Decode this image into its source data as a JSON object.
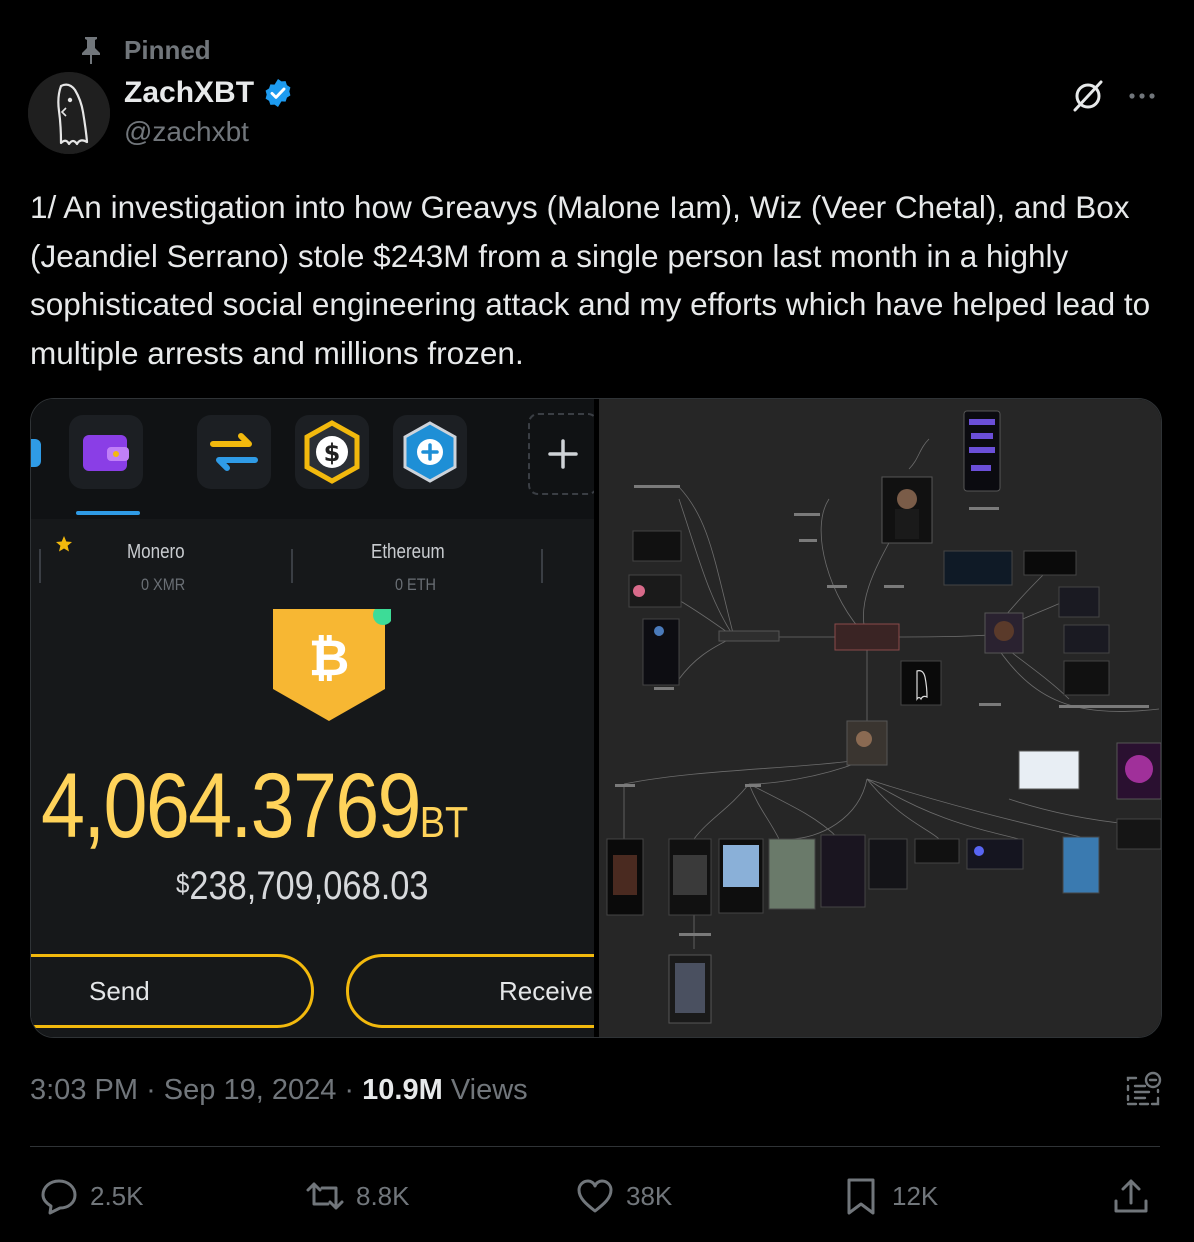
{
  "pinned": {
    "label": "Pinned"
  },
  "author": {
    "name": "ZachXBT",
    "handle": "@zachxbt",
    "verified": true
  },
  "tweet": {
    "text": "1/ An investigation into how Greavys (Malone Iam), Wiz (Veer Chetal), and Box (Jeandiel Serrano) stole $243M from a single person last month in a highly sophisticated social engineering attack and my efforts which have helped lead to multiple arrests and millions frozen."
  },
  "media": {
    "wallet": {
      "tabs": [
        {
          "name": "Monero",
          "balance": "0 XMR"
        },
        {
          "name": "Ethereum",
          "balance": "0 ETH"
        }
      ],
      "amount": "4,064.3769",
      "unit": "BT",
      "usd_value": "238,709,068.03",
      "usd_symbol": "$",
      "send_label": "Send",
      "receive_label": "Receive"
    }
  },
  "meta": {
    "time": "3:03 PM",
    "separator": "·",
    "date": "Sep 19, 2024",
    "views_count": "10.9M",
    "views_label": "Views"
  },
  "actions": {
    "replies": "2.5K",
    "reposts": "8.8K",
    "likes": "38K",
    "bookmarks": "12K"
  },
  "colors": {
    "background": "#000000",
    "text": "#e7e9ea",
    "muted": "#71767b",
    "verified": "#1d9bf0",
    "wallet_gold": "#f2b90d"
  }
}
